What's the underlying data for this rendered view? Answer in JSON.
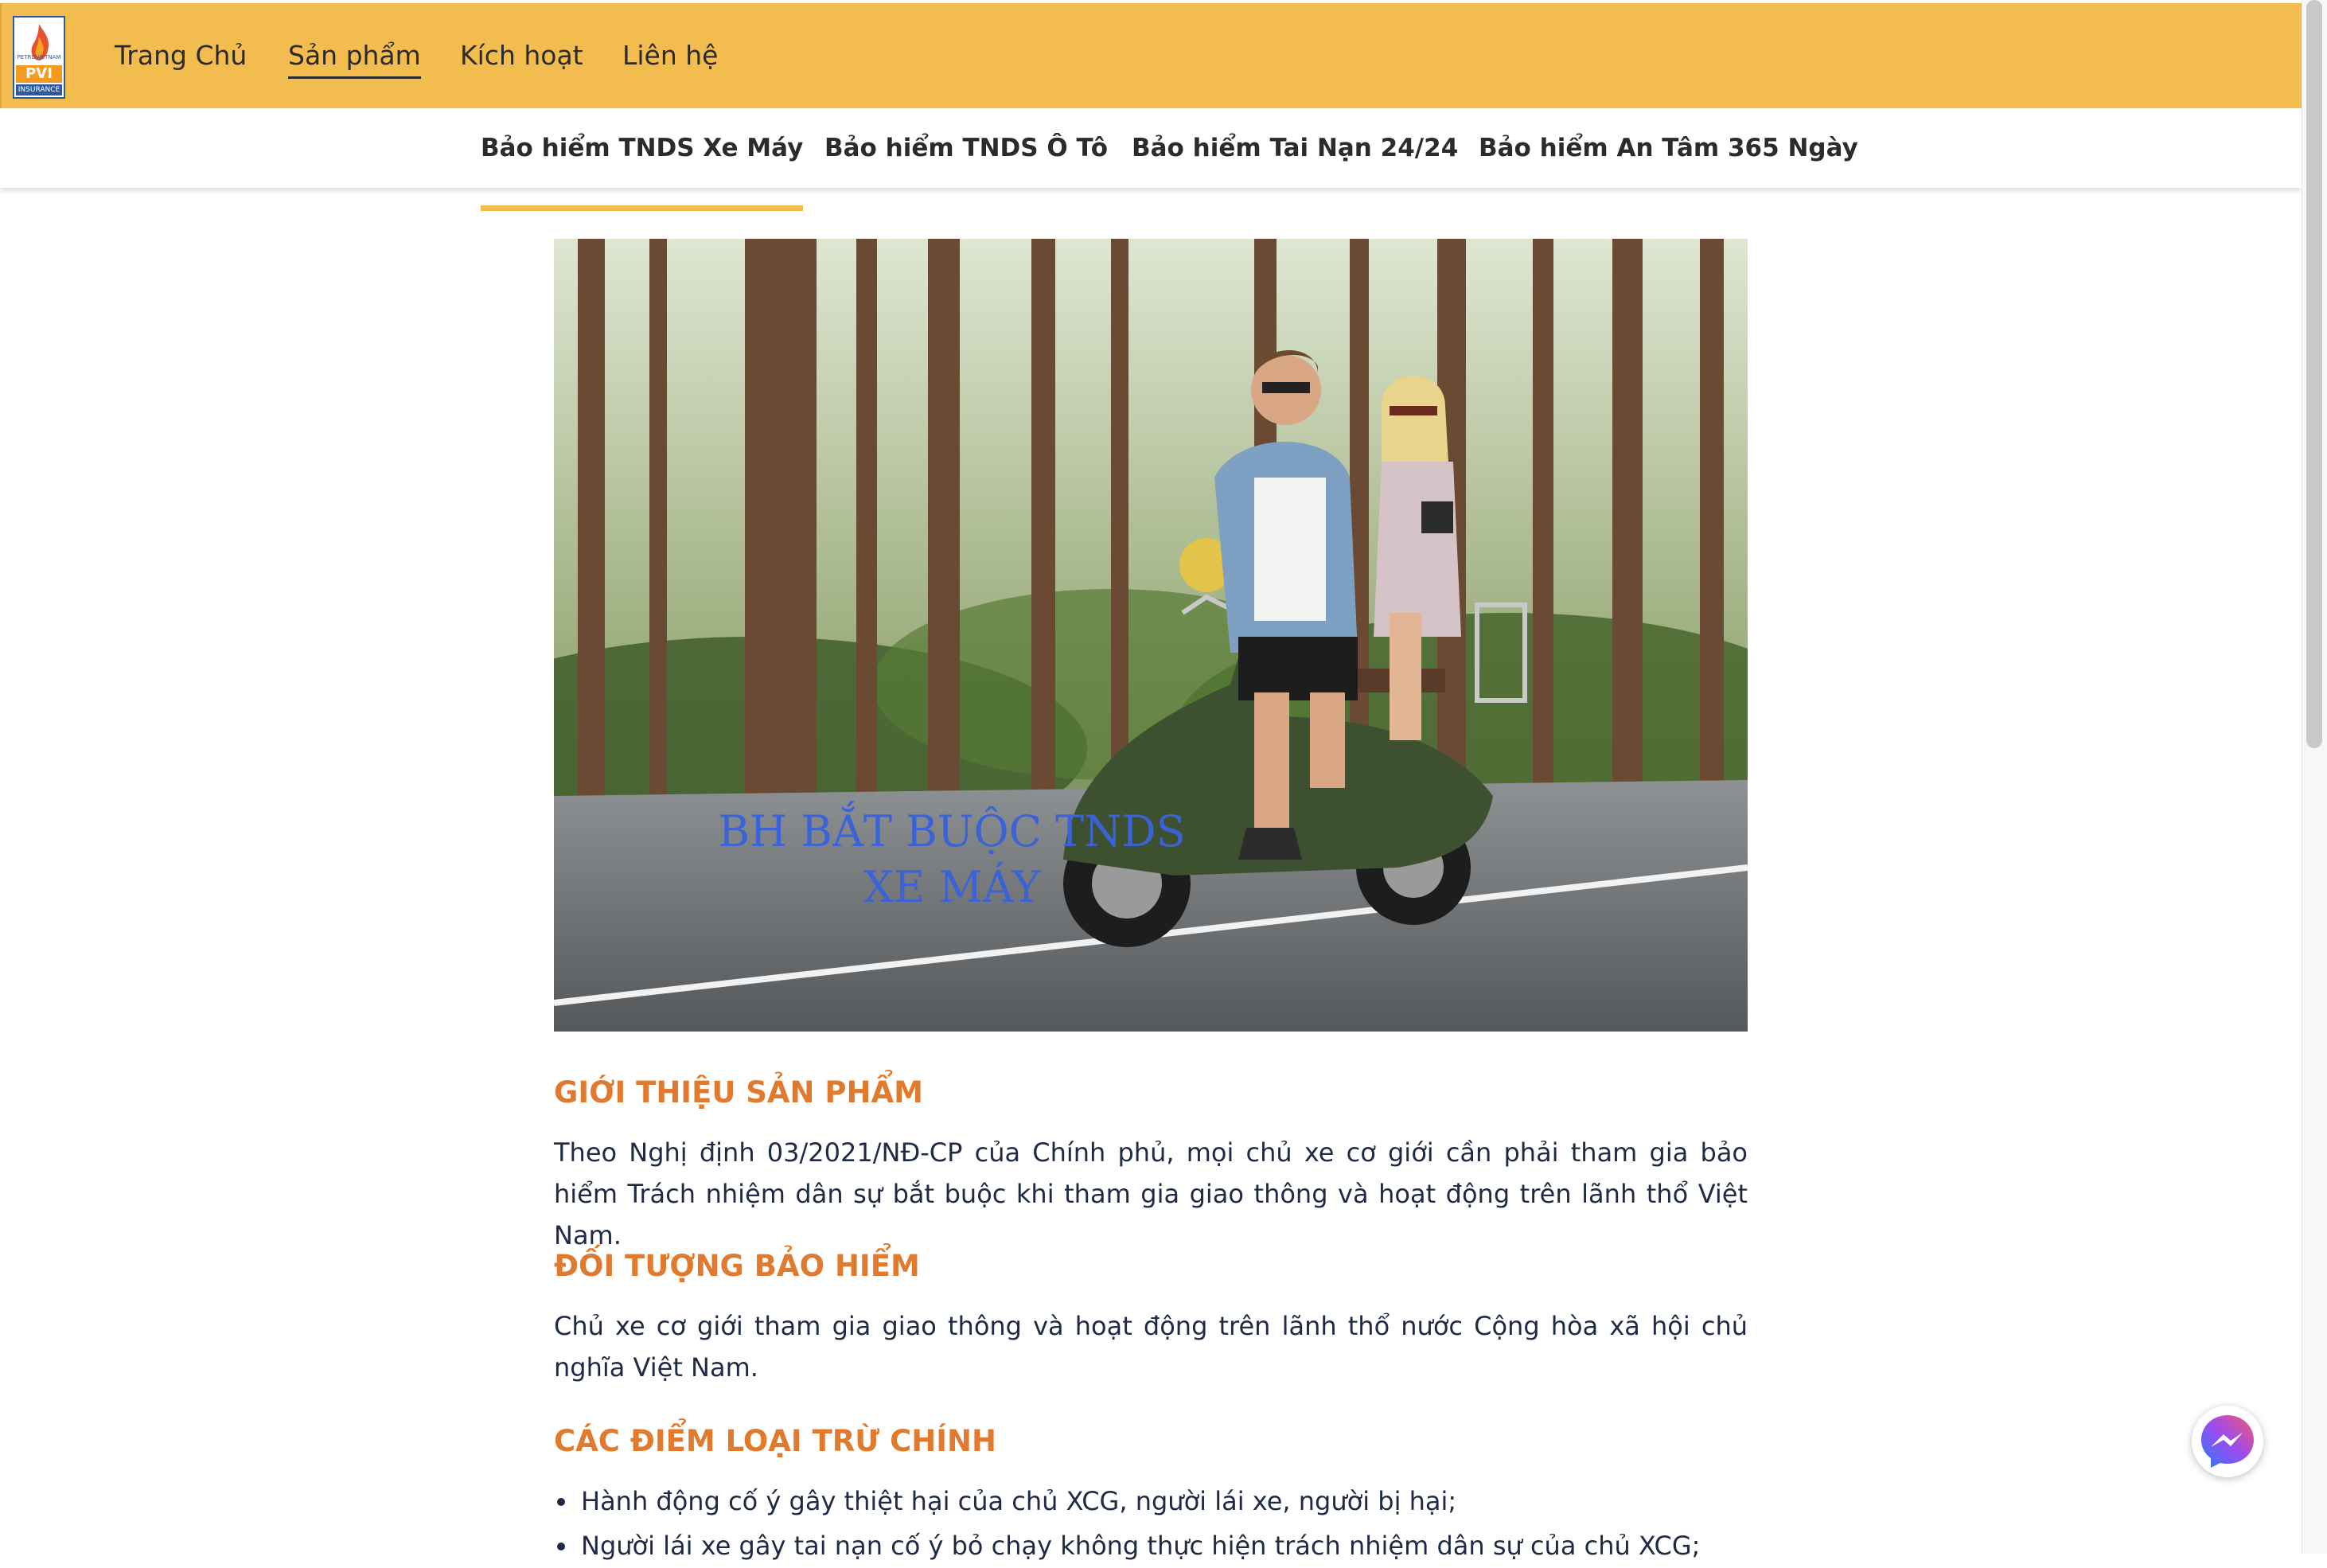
{
  "logo": {
    "brand": "PVI",
    "sub": "INSURANCE",
    "tiny": "PETROVIETNAM"
  },
  "nav": {
    "items": [
      "Trang Chủ",
      "Sản phẩm",
      "Kích hoạt",
      "Liên hệ"
    ],
    "active": "Sản phẩm"
  },
  "subnav": {
    "tabs": [
      "Bảo hiểm TNDS Xe Máy",
      "Bảo hiểm TNDS Ô Tô",
      "Bảo hiểm Tai Nạn 24/24",
      "Bảo hiểm An Tâm 365 Ngày"
    ],
    "active": "Bảo hiểm TNDS Xe Máy"
  },
  "hero": {
    "caption_line1": "BH BẮT BUỘC TNDS",
    "caption_line2": "XE MÁY"
  },
  "sections": [
    {
      "heading": "GIỚI THIỆU SẢN PHẨM",
      "text": "Theo Nghị định 03/2021/NĐ-CP của Chính phủ, mọi chủ xe cơ giới cần phải tham gia bảo hiểm Trách nhiệm dân sự bắt buộc khi tham gia giao thông và hoạt động trên lãnh thổ Việt Nam."
    },
    {
      "heading": "ĐỐI TƯỢNG BẢO HIỂM",
      "text": "Chủ xe cơ giới tham gia giao thông và hoạt động trên lãnh thổ nước Cộng hòa xã hội chủ nghĩa Việt Nam."
    },
    {
      "heading": "CÁC ĐIỂM LOẠI TRỪ CHÍNH",
      "bullets": [
        "Hành động cố ý gây thiệt hại của chủ XCG, người lái xe, người bị hại;",
        "Người lái xe gây tai nạn cố ý bỏ chạy không thực hiện trách nhiệm dân sự của chủ XCG;"
      ]
    }
  ],
  "colors": {
    "header": "#f2bc4e",
    "heading": "#e07a2e",
    "caption": "#3b63d6",
    "text": "#1f2a44"
  },
  "icons": {
    "chat": "messenger-icon"
  }
}
